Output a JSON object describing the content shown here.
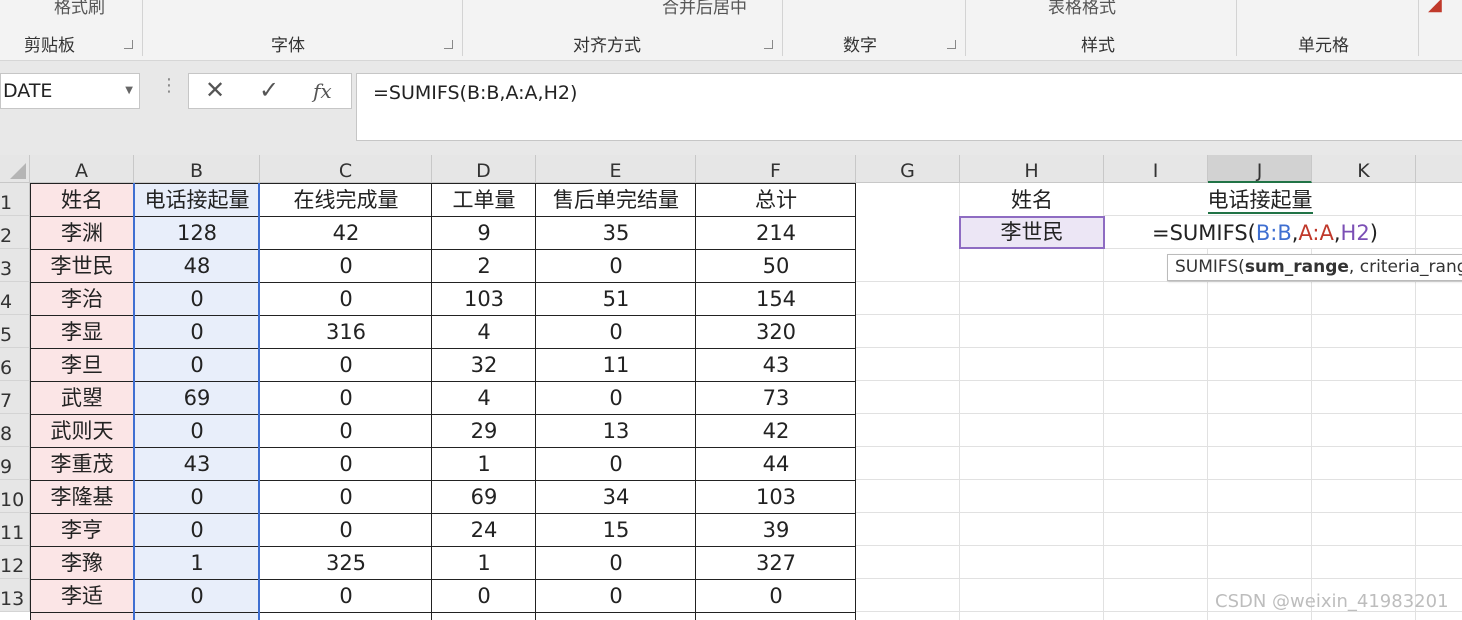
{
  "ribbon": {
    "top_labels": [
      "格式刷",
      "合并后居中",
      "表格格式"
    ],
    "groups": [
      "剪贴板",
      "字体",
      "对齐方式",
      "数字",
      "样式",
      "单元格"
    ]
  },
  "formula_bar": {
    "name_box": "DATE",
    "cancel_icon": "✕",
    "enter_icon": "✓",
    "fx_label": "fx",
    "formula": "=SUMIFS(B:B,A:A,H2)"
  },
  "columns": [
    "A",
    "B",
    "C",
    "D",
    "E",
    "F",
    "G",
    "H",
    "I",
    "J",
    "K"
  ],
  "rows": [
    "1",
    "2",
    "3",
    "4",
    "5",
    "6",
    "7",
    "8",
    "9",
    "10",
    "11",
    "12",
    "13"
  ],
  "table": {
    "headers": [
      "姓名",
      "电话接起量",
      "在线完成量",
      "工单量",
      "售后单完结量",
      "总计"
    ],
    "data": [
      [
        "李渊",
        "128",
        "42",
        "9",
        "35",
        "214"
      ],
      [
        "李世民",
        "48",
        "0",
        "2",
        "0",
        "50"
      ],
      [
        "李治",
        "0",
        "0",
        "103",
        "51",
        "154"
      ],
      [
        "李显",
        "0",
        "316",
        "4",
        "0",
        "320"
      ],
      [
        "李旦",
        "0",
        "0",
        "32",
        "11",
        "43"
      ],
      [
        "武曌",
        "69",
        "0",
        "4",
        "0",
        "73"
      ],
      [
        "武则天",
        "0",
        "0",
        "29",
        "13",
        "42"
      ],
      [
        "李重茂",
        "43",
        "0",
        "1",
        "0",
        "44"
      ],
      [
        "李隆基",
        "0",
        "0",
        "69",
        "34",
        "103"
      ],
      [
        "李亨",
        "0",
        "0",
        "24",
        "15",
        "39"
      ],
      [
        "李豫",
        "1",
        "325",
        "1",
        "0",
        "327"
      ],
      [
        "李适",
        "0",
        "0",
        "0",
        "0",
        "0"
      ]
    ]
  },
  "lookup": {
    "header_name": "姓名",
    "header_value": "电话接起量",
    "name_value": "李世民",
    "editing_formula": {
      "prefix": "=SUMIFS(",
      "arg1": "B:B",
      "comma1": ",",
      "arg2": "A:A",
      "comma2": ",",
      "arg3": "H2",
      "suffix": ")"
    }
  },
  "tooltip": {
    "fn": "SUMIFS(",
    "arg_bold": "sum_range",
    "rest": ", criteria_rang"
  },
  "watermark": "CSDN @weixin_41983201",
  "colors": {
    "arg1": "#3f6fd1",
    "arg2": "#c0392b",
    "arg3": "#7b4fb5",
    "accent": "#217346"
  }
}
